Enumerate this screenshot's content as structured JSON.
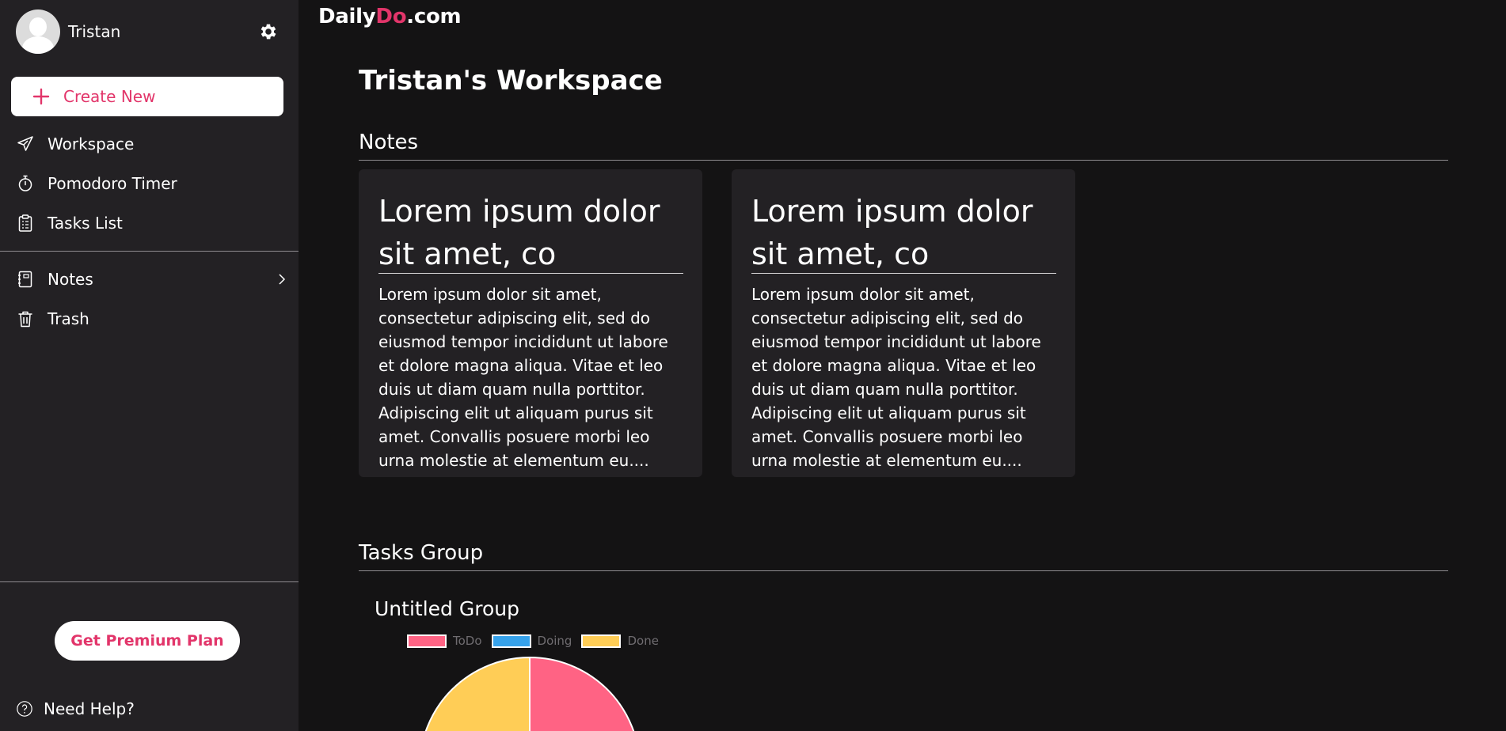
{
  "sidebar": {
    "username": "Tristan",
    "create_label": "Create New",
    "nav": [
      {
        "label": "Workspace",
        "icon": "paper-plane-icon"
      },
      {
        "label": "Pomodoro Timer",
        "icon": "stopwatch-icon"
      },
      {
        "label": "Tasks List",
        "icon": "clipboard-icon"
      }
    ],
    "nav2": [
      {
        "label": "Notes",
        "icon": "notebook-icon"
      },
      {
        "label": "Trash",
        "icon": "trash-icon"
      }
    ],
    "premium_label": "Get Premium Plan",
    "help_label": "Need Help?"
  },
  "logo": {
    "part1": "Daily",
    "part2": "Do",
    "part3": ".com"
  },
  "main": {
    "title": "Tristan's Workspace",
    "notes_heading": "Notes",
    "notes": [
      {
        "title": "Lorem ipsum dolor sit amet, co",
        "body": "Lorem ipsum dolor sit amet, consectetur adipiscing elit, sed do eiusmod tempor incididunt ut labore et dolore magna aliqua. Vitae et leo duis ut diam quam nulla porttitor. Adipiscing elit ut aliquam purus sit amet. Convallis posuere morbi leo urna molestie at elementum eu...."
      },
      {
        "title": "Lorem ipsum dolor sit amet, co",
        "body": "Lorem ipsum dolor sit amet, consectetur adipiscing elit, sed do eiusmod tempor incididunt ut labore et dolore magna aliqua. Vitae et leo duis ut diam quam nulla porttitor. Adipiscing elit ut aliquam purus sit amet. Convallis posuere morbi leo urna molestie at elementum eu...."
      }
    ],
    "tasks_heading": "Tasks Group",
    "group": {
      "title": "Untitled Group",
      "legend": [
        {
          "label": "ToDo",
          "color": "#ff6384"
        },
        {
          "label": "Doing",
          "color": "#36a2eb"
        },
        {
          "label": "Done",
          "color": "#ffcd56"
        }
      ]
    }
  },
  "colors": {
    "accent": "#e2356a",
    "sidebar_bg": "#232124",
    "page_bg": "#141314"
  }
}
